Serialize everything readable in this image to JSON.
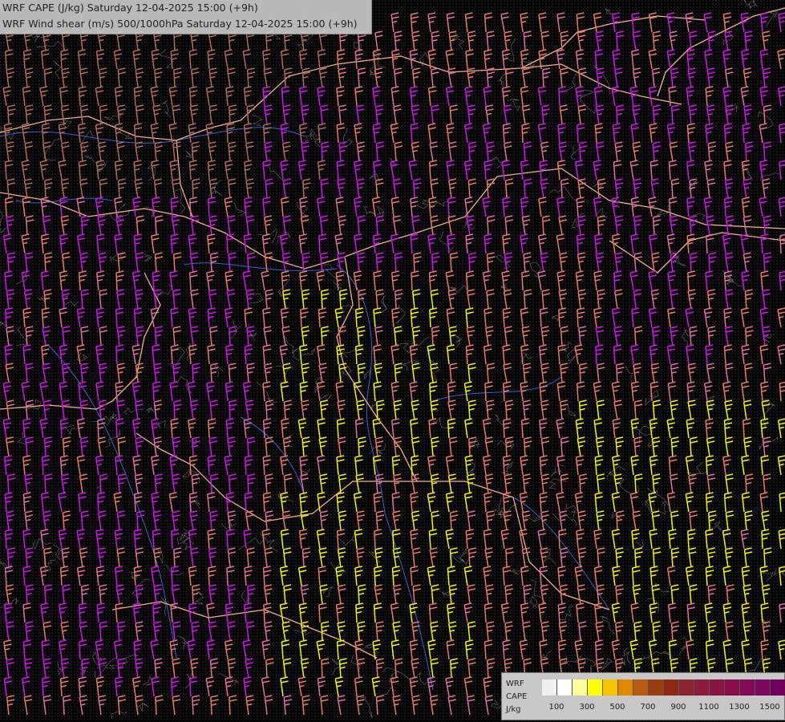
{
  "titles": {
    "line1": "WRF CAPE (J/kg) Saturday 12-04-2025 15:00 (+9h)",
    "line2": "WRF Wind shear (m/s) 500/1000hPa Saturday 12-04-2025 15:00 (+9h)"
  },
  "legend": {
    "model": "WRF",
    "param": "CAPE",
    "unit": "J/kg",
    "colors": [
      "#f0f0f0",
      "#ffffff",
      "#ffff99",
      "#ffff00",
      "#f5c400",
      "#e08a00",
      "#b85a10",
      "#9a3d10",
      "#8c2a14",
      "#8a2430",
      "#8c1c3c",
      "#8a1444",
      "#860c4c",
      "#820a56",
      "#7a0a5e",
      "#70005a"
    ],
    "tick_labels": [
      "100",
      "300",
      "500",
      "700",
      "900",
      "1100",
      "1300",
      "1500"
    ]
  },
  "map_colors": {
    "barb_pink": "#e06fa0",
    "barb_magenta": "#d015e8",
    "barb_yellow": "#f5f500",
    "barb_salmon": "#e87a6a",
    "barb_brown": "#b06a60",
    "border": "#f0b090",
    "river": "#3a5fd0",
    "terrain": "#b0b0b0"
  }
}
